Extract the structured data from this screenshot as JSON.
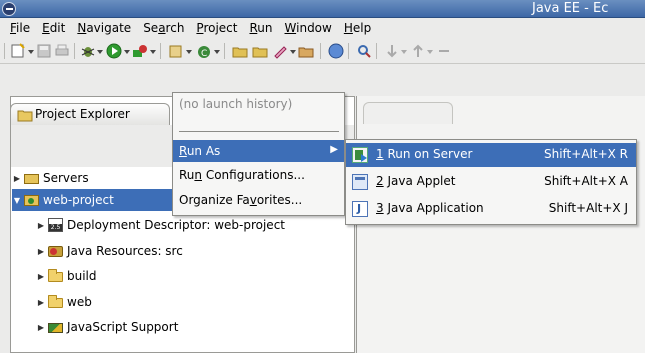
{
  "window": {
    "title": "Java EE - Ec"
  },
  "menubar": [
    {
      "pre": "",
      "u": "F",
      "post": "ile"
    },
    {
      "pre": "",
      "u": "E",
      "post": "dit"
    },
    {
      "pre": "",
      "u": "N",
      "post": "avigate"
    },
    {
      "pre": "Se",
      "u": "a",
      "post": "rch"
    },
    {
      "pre": "",
      "u": "P",
      "post": "roject"
    },
    {
      "pre": "",
      "u": "R",
      "post": "un"
    },
    {
      "pre": "",
      "u": "W",
      "post": "indow"
    },
    {
      "pre": "",
      "u": "H",
      "post": "elp"
    }
  ],
  "explorer": {
    "tab_label": "Project Explorer",
    "tree": [
      {
        "label": "Servers",
        "expanded": false,
        "level": 0,
        "icon": "folder-icon"
      },
      {
        "label": "web-project",
        "expanded": true,
        "level": 0,
        "selected": true,
        "icon": "web-project-icon"
      },
      {
        "label": "Deployment Descriptor: web-project",
        "expanded": false,
        "level": 1,
        "icon": "deployment-descriptor-icon"
      },
      {
        "label": "Java Resources: src",
        "expanded": false,
        "level": 1,
        "icon": "java-resources-icon"
      },
      {
        "label": "build",
        "expanded": false,
        "level": 1,
        "icon": "folder-icon"
      },
      {
        "label": "web",
        "expanded": false,
        "level": 1,
        "icon": "folder-icon"
      },
      {
        "label": "JavaScript Support",
        "expanded": false,
        "level": 1,
        "icon": "javascript-support-icon"
      }
    ]
  },
  "run_menu": {
    "no_history": "(no launch history)",
    "run_as": {
      "pre": "",
      "u": "R",
      "post": "un As"
    },
    "run_configurations": {
      "pre": "Ru",
      "u": "n",
      "post": " Configurations..."
    },
    "organize_favorites": {
      "pre": "Organize Fa",
      "u": "v",
      "post": "orites..."
    }
  },
  "run_as_submenu": [
    {
      "num": "1",
      "label": " Run on Server",
      "accel": "Shift+Alt+X R",
      "icon": "run-on-server-icon",
      "active": true
    },
    {
      "num": "2",
      "label": " Java Applet",
      "accel": "Shift+Alt+X A",
      "icon": "java-applet-icon",
      "active": false
    },
    {
      "num": "3",
      "label": " Java Application",
      "accel": "Shift+Alt+X J",
      "icon": "java-application-icon",
      "active": false
    }
  ],
  "colors": {
    "selection": "#3d6eb7",
    "titlebar": "#4a74b0"
  }
}
